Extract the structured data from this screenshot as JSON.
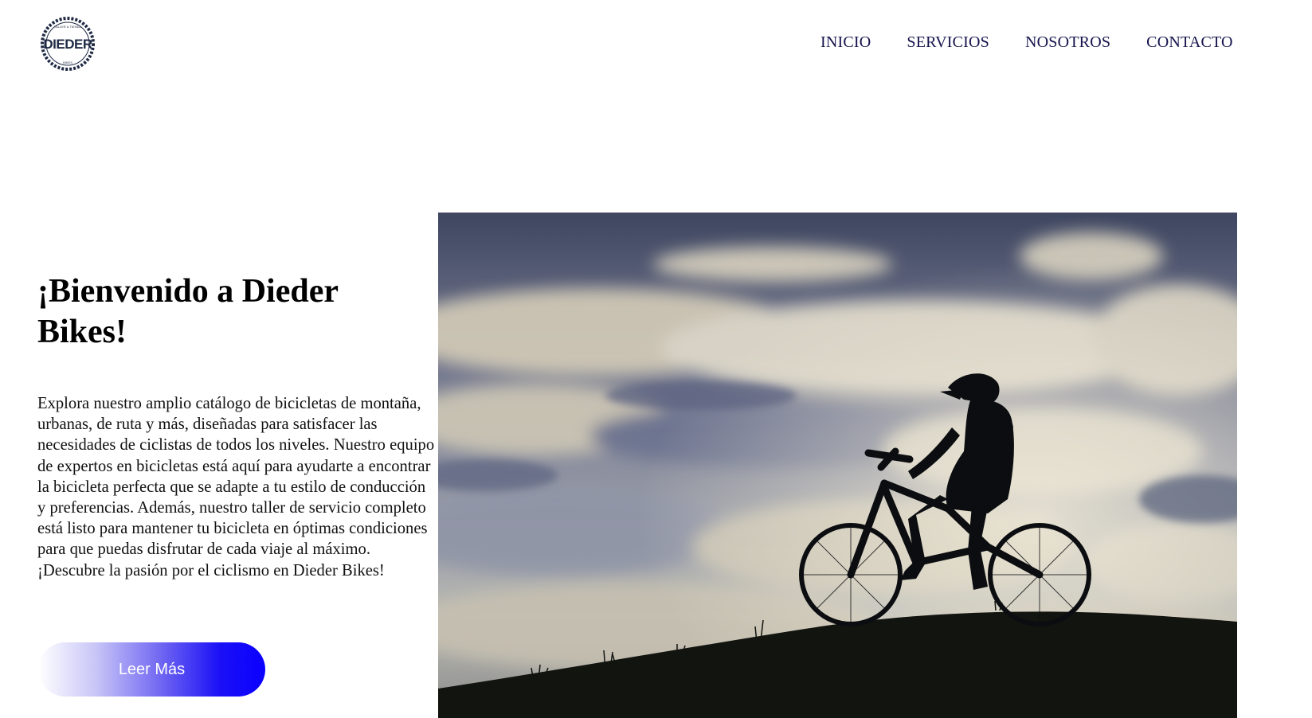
{
  "header": {
    "logo_text": "DIEDER",
    "logo_ring_top": "TALLER & TIENDA",
    "logo_ring_bottom": "BIKES",
    "nav": [
      {
        "label": "INICIO"
      },
      {
        "label": "SERVICIOS"
      },
      {
        "label": "NOSOTROS"
      },
      {
        "label": "CONTACTO"
      }
    ]
  },
  "hero": {
    "title": "¡Bienvenido a Dieder Bikes!",
    "description": "Explora nuestro amplio catálogo de bicicletas de montaña, urbanas, de ruta y más, diseñadas para satisfacer las necesidades de ciclistas de todos los niveles. Nuestro equipo de expertos en bicicletas está aquí para ayudarte a encontrar la bicicleta perfecta que se adapte a tu estilo de conducción y preferencias. Además, nuestro taller de servicio completo está listo para mantener tu bicicleta en óptimas condiciones para que puedas disfrutar de cada viaje al máximo. ¡Descubre la pasión por el ciclismo en Dieder Bikes!",
    "button_label": "Leer Más"
  },
  "colors": {
    "nav_text": "#15134d",
    "button_gradient_end": "#0a00ff"
  }
}
